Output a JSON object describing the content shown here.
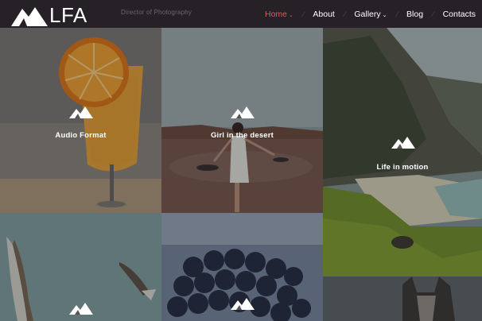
{
  "header": {
    "logo_text": "LFA",
    "tagline": "Director of Photography",
    "nav": [
      {
        "label": "Home",
        "active": true,
        "has_dropdown": true
      },
      {
        "label": "About",
        "active": false,
        "has_dropdown": false
      },
      {
        "label": "Gallery",
        "active": false,
        "has_dropdown": true
      },
      {
        "label": "Blog",
        "active": false,
        "has_dropdown": false
      },
      {
        "label": "Contacts",
        "active": false,
        "has_dropdown": false
      }
    ]
  },
  "gallery": {
    "items": [
      {
        "caption": "Audio Format",
        "icon": "mountain-icon"
      },
      {
        "caption": "Girl in the desert",
        "icon": "mountain-icon"
      },
      {
        "caption": "Life in motion",
        "icon": "mountain-icon"
      },
      {
        "caption": "",
        "icon": "mountain-icon"
      },
      {
        "caption": "",
        "icon": "mountain-icon"
      },
      {
        "caption": "",
        "icon": ""
      }
    ]
  },
  "colors": {
    "accent": "#e05a4f",
    "header_bg": "#262126"
  }
}
